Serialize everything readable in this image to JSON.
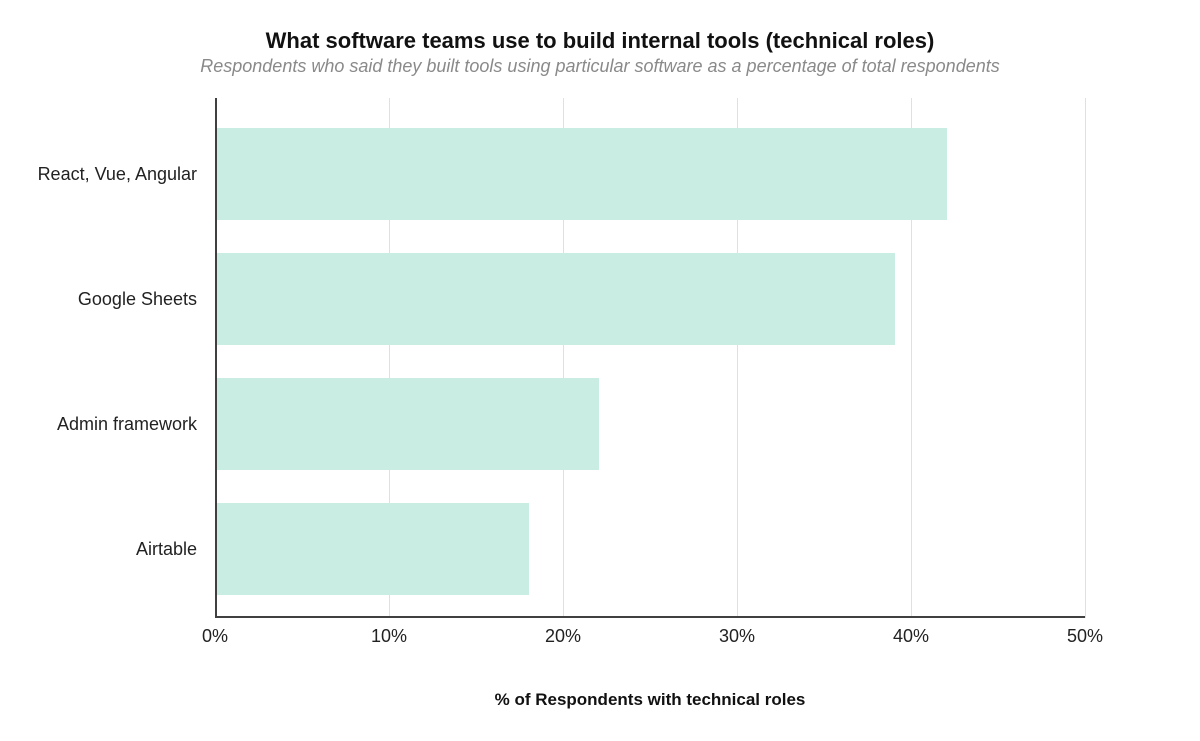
{
  "chart_data": {
    "type": "bar",
    "orientation": "horizontal",
    "title": "What software teams use to build internal tools (technical roles)",
    "subtitle": "Respondents who said they built tools using particular software as a percentage of total respondents",
    "xlabel": "% of Respondents with technical roles",
    "ylabel": "",
    "categories": [
      "React, Vue, Angular",
      "Google Sheets",
      "Admin framework",
      "Airtable"
    ],
    "values": [
      42,
      39,
      22,
      18
    ],
    "xlim": [
      0,
      50
    ],
    "xticks": [
      0,
      10,
      20,
      30,
      40,
      50
    ],
    "xtick_labels": [
      "0%",
      "10%",
      "20%",
      "30%",
      "40%",
      "50%"
    ],
    "bar_color": "#c9ede3"
  }
}
